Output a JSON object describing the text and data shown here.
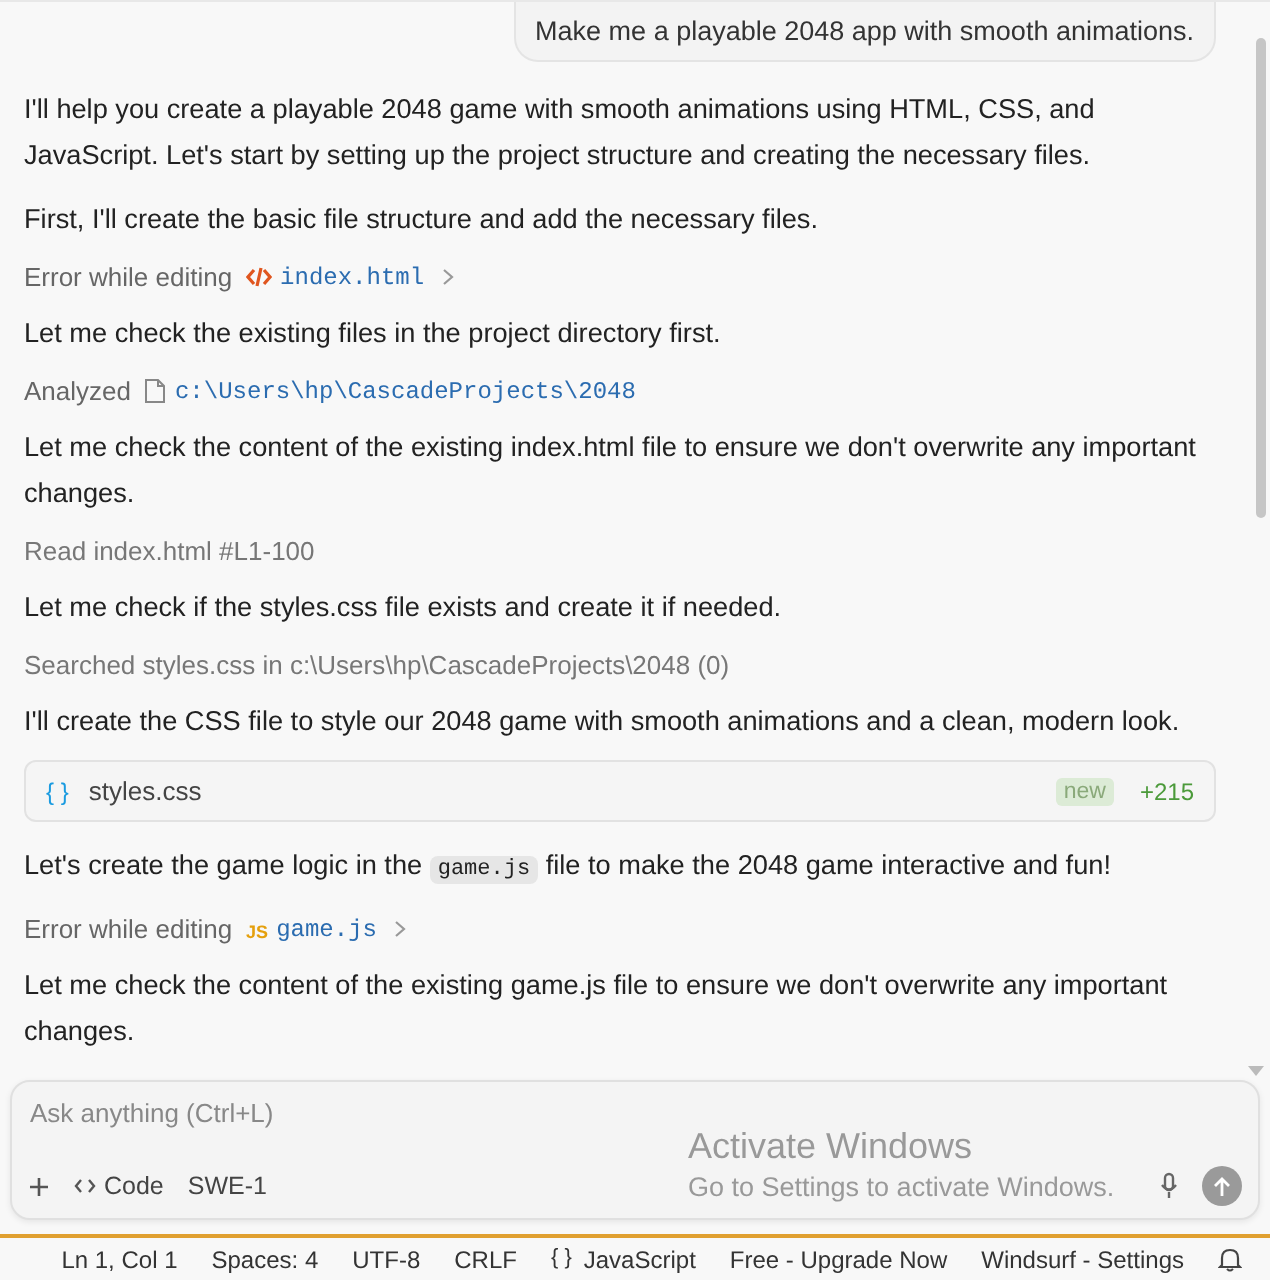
{
  "user_message": "Make me a playable 2048 app with smooth animations.",
  "messages": [
    {
      "kind": "text",
      "text": "I'll help you create a playable 2048 game with smooth animations using HTML, CSS, and JavaScript. Let's start by setting up the project structure and creating the necessary files."
    },
    {
      "kind": "text",
      "text": "First, I'll create the basic file structure and add the necessary files."
    },
    {
      "kind": "action_html",
      "label": "Error while editing",
      "target": "index.html"
    },
    {
      "kind": "text",
      "text": "Let me check the existing files in the project directory first."
    },
    {
      "kind": "action_file",
      "label": "Analyzed",
      "target": "c:\\Users\\hp\\CascadeProjects\\2048"
    },
    {
      "kind": "text",
      "text": "Let me check the content of the existing index.html file to ensure we don't overwrite any important changes."
    },
    {
      "kind": "muted",
      "text": "Read index.html #L1-100"
    },
    {
      "kind": "text",
      "text": "Let me check if the styles.css file exists and create it if needed."
    },
    {
      "kind": "muted",
      "text": "Searched styles.css in c:\\Users\\hp\\CascadeProjects\\2048 (0)"
    },
    {
      "kind": "text",
      "text": "I'll create the CSS file to style our 2048 game with smooth animations and a clean, modern look."
    },
    {
      "kind": "file",
      "icon_text": "{ }",
      "name": "styles.css",
      "badge": "new",
      "diff": "+215"
    },
    {
      "kind": "rich",
      "parts": [
        {
          "kind": "plain",
          "text": "Let's create the game logic in the"
        },
        {
          "kind": "code",
          "text": "game.js"
        },
        {
          "kind": "plain",
          "text": "file to make the 2048 game interactive and fun!"
        }
      ]
    },
    {
      "kind": "action_js",
      "label": "Error while editing",
      "icon_text": "JS",
      "target": "game.js"
    },
    {
      "kind": "text",
      "text": "Let me check the content of the existing game.js file to ensure we don't overwrite any important changes."
    }
  ],
  "input": {
    "placeholder": "Ask anything (Ctrl+L)",
    "mode": "Code",
    "model": "SWE-1"
  },
  "activation": {
    "title": "Activate Windows",
    "subtitle": "Go to Settings to activate Windows."
  },
  "status_bar": [
    {
      "kind": "text",
      "text": "Ln 1, Col 1"
    },
    {
      "kind": "text",
      "text": "Spaces: 4"
    },
    {
      "kind": "text",
      "text": "UTF-8"
    },
    {
      "kind": "text",
      "text": "CRLF"
    },
    {
      "kind": "language",
      "icon_text": "{ }",
      "text": "JavaScript"
    },
    {
      "kind": "text",
      "text": "Free - Upgrade Now"
    },
    {
      "kind": "text",
      "text": "Windsurf - Settings"
    },
    {
      "kind": "bell"
    }
  ]
}
